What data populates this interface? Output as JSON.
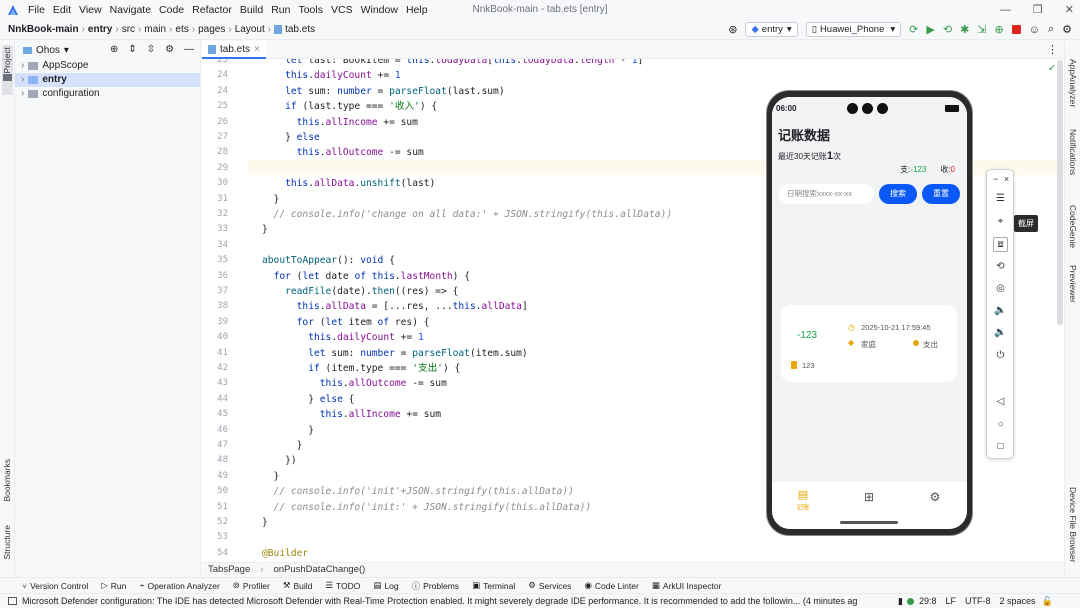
{
  "menu": [
    "File",
    "Edit",
    "View",
    "Navigate",
    "Code",
    "Refactor",
    "Build",
    "Run",
    "Tools",
    "VCS",
    "Window",
    "Help"
  ],
  "window_title": "NnkBook-main - tab.ets [entry]",
  "breadcrumbs": [
    "NnkBook-main",
    "entry",
    "src",
    "main",
    "ets",
    "pages",
    "Layout",
    "tab.ets"
  ],
  "toolbar": {
    "module": "entry",
    "device": "Huawei_Phone"
  },
  "left_strip": {
    "project": "Project",
    "bookmarks": "Bookmarks",
    "structure": "Structure"
  },
  "project_panel": {
    "view": "Ohos",
    "tree": [
      "AppScope",
      "entry",
      "configuration"
    ]
  },
  "editor_tab": "tab.ets",
  "code_lines": [
    {
      "n": "23",
      "t": "    let last: BookItem = this.todayData[this.todayData.length - 1]"
    },
    {
      "n": "24",
      "t": "    this.dailyCount += 1"
    },
    {
      "n": "24",
      "t": "    let sum: number = parseFloat(last.sum)"
    },
    {
      "n": "25",
      "t": "    if (last.type === '收入') {"
    },
    {
      "n": "26",
      "t": "      this.allIncome += sum"
    },
    {
      "n": "27",
      "t": "    } else "
    },
    {
      "n": "28",
      "t": "      this.allOutcome -= sum"
    },
    {
      "n": "29",
      "t": "    "
    },
    {
      "n": "30",
      "t": "    this.allData.unshift(last)"
    },
    {
      "n": "31",
      "t": "  }"
    },
    {
      "n": "32",
      "t": "  // console.info('change on all data:' + JSON.stringify(this.allData))"
    },
    {
      "n": "33",
      "t": "}"
    },
    {
      "n": "34",
      "t": ""
    },
    {
      "n": "35",
      "t": "aboutToAppear(): void {"
    },
    {
      "n": "36",
      "t": "  for (let date of this.lastMonth) {"
    },
    {
      "n": "37",
      "t": "    readFile(date).then((res) => {"
    },
    {
      "n": "38",
      "t": "      this.allData = [...res, ...this.allData]"
    },
    {
      "n": "39",
      "t": "      for (let item of res) {"
    },
    {
      "n": "40",
      "t": "        this.dailyCount += 1"
    },
    {
      "n": "41",
      "t": "        let sum: number = parseFloat(item.sum)"
    },
    {
      "n": "42",
      "t": "        if (item.type === '支出') {"
    },
    {
      "n": "43",
      "t": "          this.allOutcome -= sum"
    },
    {
      "n": "44",
      "t": "        } else {"
    },
    {
      "n": "45",
      "t": "          this.allIncome += sum"
    },
    {
      "n": "46",
      "t": "        }"
    },
    {
      "n": "47",
      "t": "      }"
    },
    {
      "n": "48",
      "t": "    })"
    },
    {
      "n": "49",
      "t": "  }"
    },
    {
      "n": "50",
      "t": "  // console.info('init'+JSON.stringify(this.allData))"
    },
    {
      "n": "51",
      "t": "  // console.info('init:' + JSON.stringify(this.allData))"
    },
    {
      "n": "52",
      "t": "}"
    },
    {
      "n": "53",
      "t": ""
    },
    {
      "n": "54",
      "t": "@Builder"
    }
  ],
  "editor_breadcrumb": [
    "TabsPage",
    "onPushDataChange()"
  ],
  "right_strip": {
    "a": "AppAnalyzer",
    "b": "Notifications",
    "c": "CodeGenie",
    "d": "Previewer",
    "e": "Device File Browser"
  },
  "tool_windows": [
    "Version Control",
    "Run",
    "Operation Analyzer",
    "Profiler",
    "Build",
    "TODO",
    "Log",
    "Problems",
    "Terminal",
    "Services",
    "Code Linter",
    "ArkUI Inspector"
  ],
  "status": {
    "message": "Microsoft Defender configuration: The IDE has detected Microsoft Defender with Real-Time Protection enabled. It might severely degrade IDE performance. It is recommended to add the followin... (4 minutes ag",
    "position": "29:8",
    "eol": "LF",
    "encoding": "UTF-8",
    "indent": "2 spaces"
  },
  "phone": {
    "time": "06:00",
    "title": "记账数据",
    "summary_prefix": "最近30天记账",
    "summary_count": "1",
    "summary_suffix": "次",
    "out_label": "支:",
    "out_value": "-123",
    "in_label": "收:",
    "in_value": "0",
    "search_placeholder": "日期搜索xxxx-xx-xx",
    "search_btn": "搜索",
    "reset_btn": "重置",
    "record": {
      "amount": "-123",
      "time": "2025-10-21 17:59:45",
      "category": "家庭",
      "type": "支出",
      "note": "123"
    },
    "tabs": [
      "记账",
      "",
      ""
    ]
  },
  "tooltip": "截屏",
  "colors": {
    "accent": "#3574f0",
    "phone_blue": "#0a59f7",
    "green": "#12a84a",
    "red": "#e0241c"
  }
}
